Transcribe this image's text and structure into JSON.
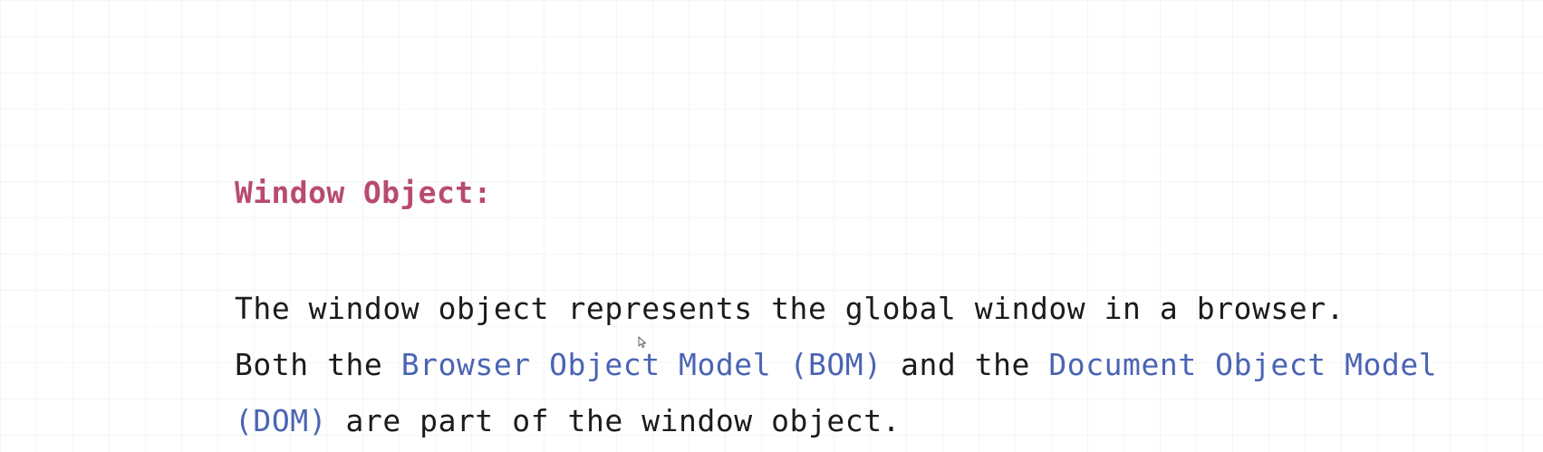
{
  "heading": "Window Object:",
  "paragraph": {
    "line1": {
      "text": "The window object represents the global window in a browser."
    },
    "line2": {
      "before": "Both the ",
      "link1": "Browser Object Model (BOM)",
      "middle": " and the ",
      "link2_part1": "Document Object Model"
    },
    "line3": {
      "link2_part2": "(DOM)",
      "after": " are part of the window object."
    }
  },
  "colors": {
    "heading": "#b84b6f",
    "highlight": "#4a64b4",
    "body_text": "#1b1b1b",
    "background": "#ffffff"
  },
  "icons": {
    "pointer": "mouse-cursor-icon"
  }
}
